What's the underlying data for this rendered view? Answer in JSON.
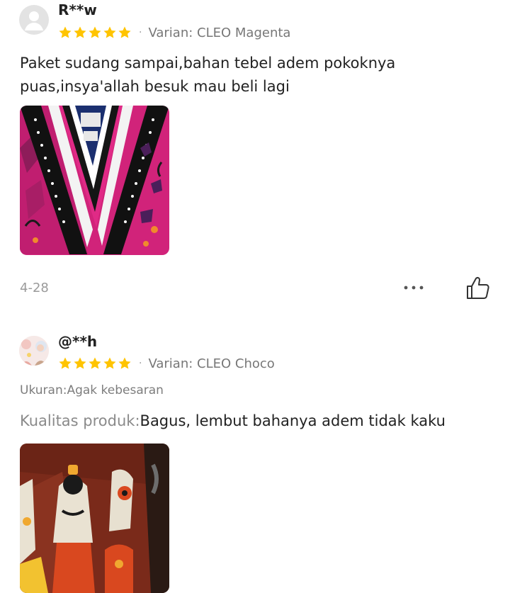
{
  "reviews": [
    {
      "username": "R**w",
      "avatar_icon": "default-user-avatar-icon",
      "rating": 5,
      "variant": "Varian: CLEO Magenta",
      "text": "Paket sudang sampai,bahan tebel adem pokoknya puas,insya'allah besuk mau beli lagi",
      "photo": "magenta-batik-garment-photo",
      "date": "4-28"
    },
    {
      "username": "@**h",
      "avatar_icon": "user-profile-photo",
      "rating": 5,
      "variant": "Varian: CLEO Choco",
      "size_label": "Ukuran:Agak kebesaran",
      "quality_key": "Kualitas produk:",
      "quality_value": "Bagus, lembut bahanya adem tidak kaku",
      "photo": "choco-batik-garment-photo"
    }
  ],
  "colors": {
    "star": "#FFC400",
    "primary_text": "#222222",
    "secondary_text": "#777777",
    "date_text": "#9A9A9A"
  },
  "icons": {
    "separator": "·",
    "more": "more-options-icon",
    "like": "thumbs-up-icon"
  }
}
